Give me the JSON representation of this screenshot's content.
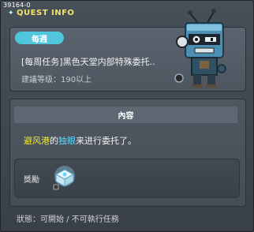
{
  "window": {
    "quest_id": "39164-0",
    "title": "QUEST INFO"
  },
  "quest": {
    "badge": "每週",
    "name": "[每周任务]黑色天堂内部特殊委托..",
    "level": "建議等级：190以上"
  },
  "content": {
    "header": "內容",
    "text_place": "避风港",
    "text_particle": "的",
    "text_npc": "独眼",
    "text_rest": "来进行委托了。"
  },
  "reward": {
    "label": "獎勵",
    "item_icon": "reward-chest-icon"
  },
  "status": {
    "text": "狀態：可開始 / 不可執行任務"
  },
  "colors": {
    "title": "#f3e36a",
    "badge": "#50c6dd",
    "highlight_place": "#f2ea2c",
    "highlight_npc": "#60d8ff"
  }
}
